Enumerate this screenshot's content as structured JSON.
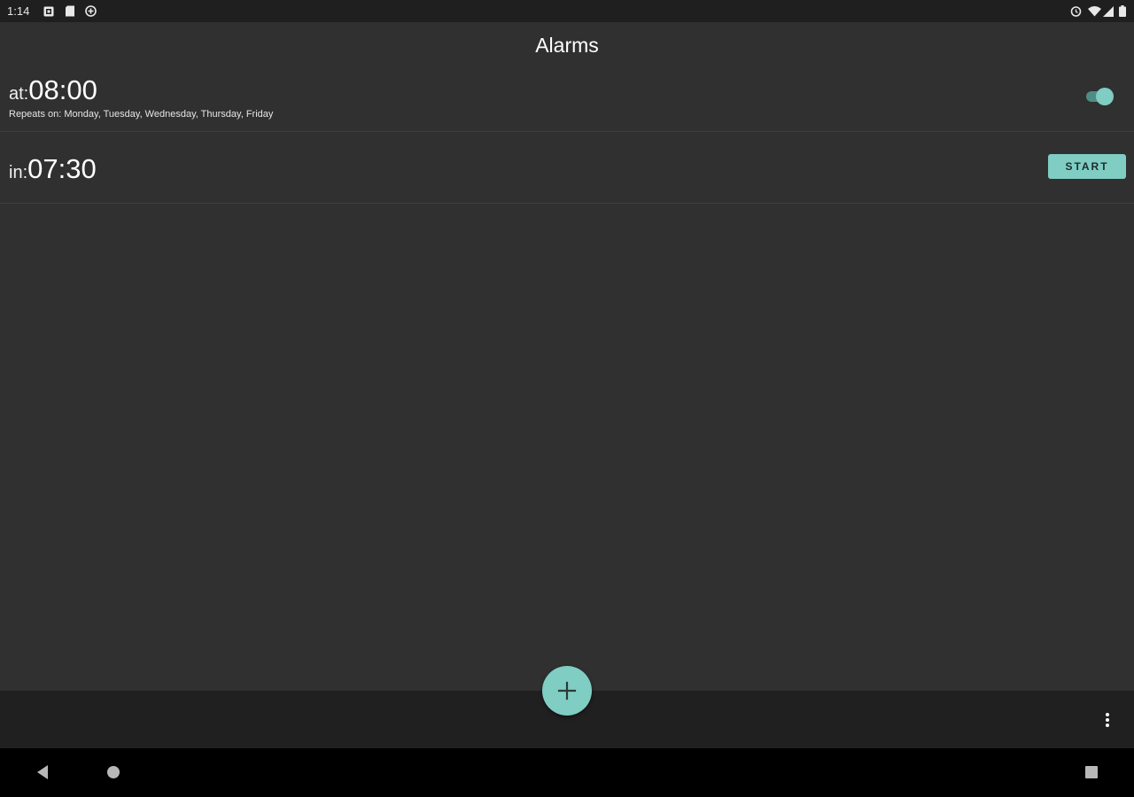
{
  "status_bar": {
    "time": "1:14",
    "left_icons": [
      "notification-icon",
      "sd-card-icon",
      "data-saver-icon"
    ],
    "right_icons": [
      "alarm-icon",
      "wifi-icon",
      "signal-icon",
      "battery-icon"
    ]
  },
  "app_bar": {
    "title": "Alarms"
  },
  "alarms": [
    {
      "prefix": "at:",
      "time": "08:00",
      "repeats": "Repeats on: Monday, Tuesday, Wednesday, Thursday, Friday",
      "enabled": true
    },
    {
      "prefix": "in:",
      "time": "07:30",
      "action_label": "START"
    }
  ],
  "bottom_bar": {
    "fab_icon": "plus-icon",
    "menu_icon": "more-vert-icon"
  },
  "nav_bar": {
    "icons": [
      "back-icon",
      "home-icon",
      "recents-icon"
    ]
  },
  "colors": {
    "accent": "#7fcdc3",
    "background": "#303030",
    "bottom_bar": "#202020",
    "status_bar": "#1f1f1f",
    "nav_bar": "#000000"
  }
}
